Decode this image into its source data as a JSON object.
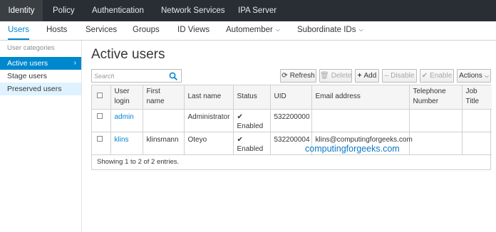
{
  "topnav": {
    "tabs": [
      {
        "label": "Identity",
        "active": true
      },
      {
        "label": "Policy",
        "active": false
      },
      {
        "label": "Authentication",
        "active": false
      },
      {
        "label": "Network Services",
        "active": false
      },
      {
        "label": "IPA Server",
        "active": false
      }
    ]
  },
  "subnav": {
    "items": [
      {
        "label": "Users",
        "active": true
      },
      {
        "label": "Hosts"
      },
      {
        "label": "Services"
      },
      {
        "label": "Groups"
      },
      {
        "label": "ID Views"
      },
      {
        "label": "Automember",
        "dropdown": true
      },
      {
        "label": "Subordinate IDs",
        "dropdown": true
      }
    ]
  },
  "sidebar": {
    "category_label": "User categories",
    "items": [
      {
        "label": "Active users",
        "active": true
      },
      {
        "label": "Stage users"
      },
      {
        "label": "Preserved users"
      }
    ]
  },
  "main": {
    "title": "Active users",
    "search": {
      "placeholder": "Search",
      "value": ""
    },
    "buttons": {
      "refresh": "Refresh",
      "delete": "Delete",
      "add": "Add",
      "disable": "Disable",
      "enable": "Enable",
      "actions": "Actions"
    },
    "table": {
      "columns": {
        "login": "User login",
        "first": "First name",
        "last": "Last name",
        "status": "Status",
        "uid": "UID",
        "email": "Email address",
        "phone": "Telephone Number",
        "job": "Job Title"
      },
      "rows": [
        {
          "login": "admin",
          "first": "",
          "last": "Administrator",
          "status": "Enabled",
          "uid": "532200000",
          "email": "",
          "phone": "",
          "job": ""
        },
        {
          "login": "klins",
          "first": "klinsmann",
          "last": "Oteyo",
          "status": "Enabled",
          "uid": "532200004",
          "email": "klins@computingforgeeks.com",
          "phone": "",
          "job": ""
        }
      ],
      "footer": "Showing 1 to 2 of 2 entries."
    }
  },
  "watermark": "computingforgeeks.com",
  "colors": {
    "accent": "#0088ce",
    "topnav_bg": "#292e34",
    "sidebar_selected_light": "#def3ff"
  },
  "icons": {
    "refresh": "refresh-icon",
    "delete": "trash-icon",
    "add": "plus-icon",
    "disable": "minus-icon",
    "enable": "check-icon",
    "actions": "chevron-down-icon",
    "search": "search-icon"
  }
}
